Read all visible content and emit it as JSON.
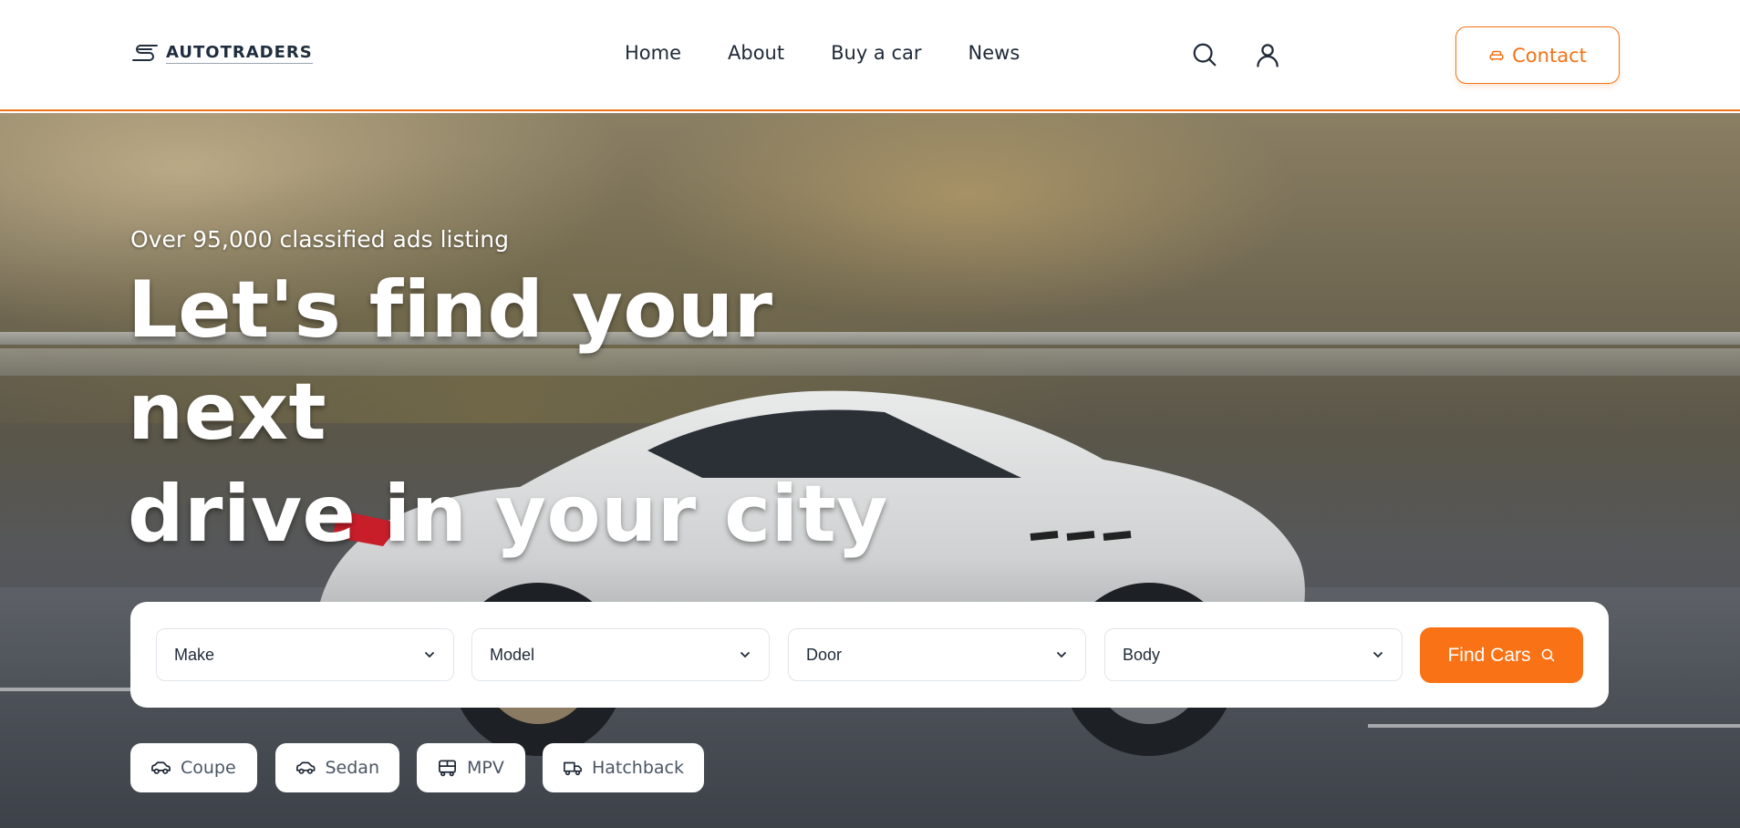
{
  "header": {
    "logo_text": "AUTOTRADERS",
    "nav": [
      "Home",
      "About",
      "Buy a car",
      "News"
    ],
    "search_icon": "search-icon",
    "user_icon": "user-icon",
    "contact_label": "Contact",
    "contact_icon": "car-icon"
  },
  "hero": {
    "tagline": "Over 95,000 classified ads listing",
    "headline_line1": "Let's find your next",
    "headline_line2": "drive in your city"
  },
  "search": {
    "selects": [
      {
        "label": "Make"
      },
      {
        "label": "Model"
      },
      {
        "label": "Door"
      },
      {
        "label": "Body"
      }
    ],
    "submit_label": "Find Cars"
  },
  "body_types": [
    {
      "label": "Coupe",
      "icon": "car-icon"
    },
    {
      "label": "Sedan",
      "icon": "car-icon"
    },
    {
      "label": "MPV",
      "icon": "bus-icon"
    },
    {
      "label": "Hatchback",
      "icon": "truck-icon"
    }
  ],
  "colors": {
    "accent": "#f97316",
    "header_border": "#f47216",
    "text_dark": "#1f2937"
  }
}
